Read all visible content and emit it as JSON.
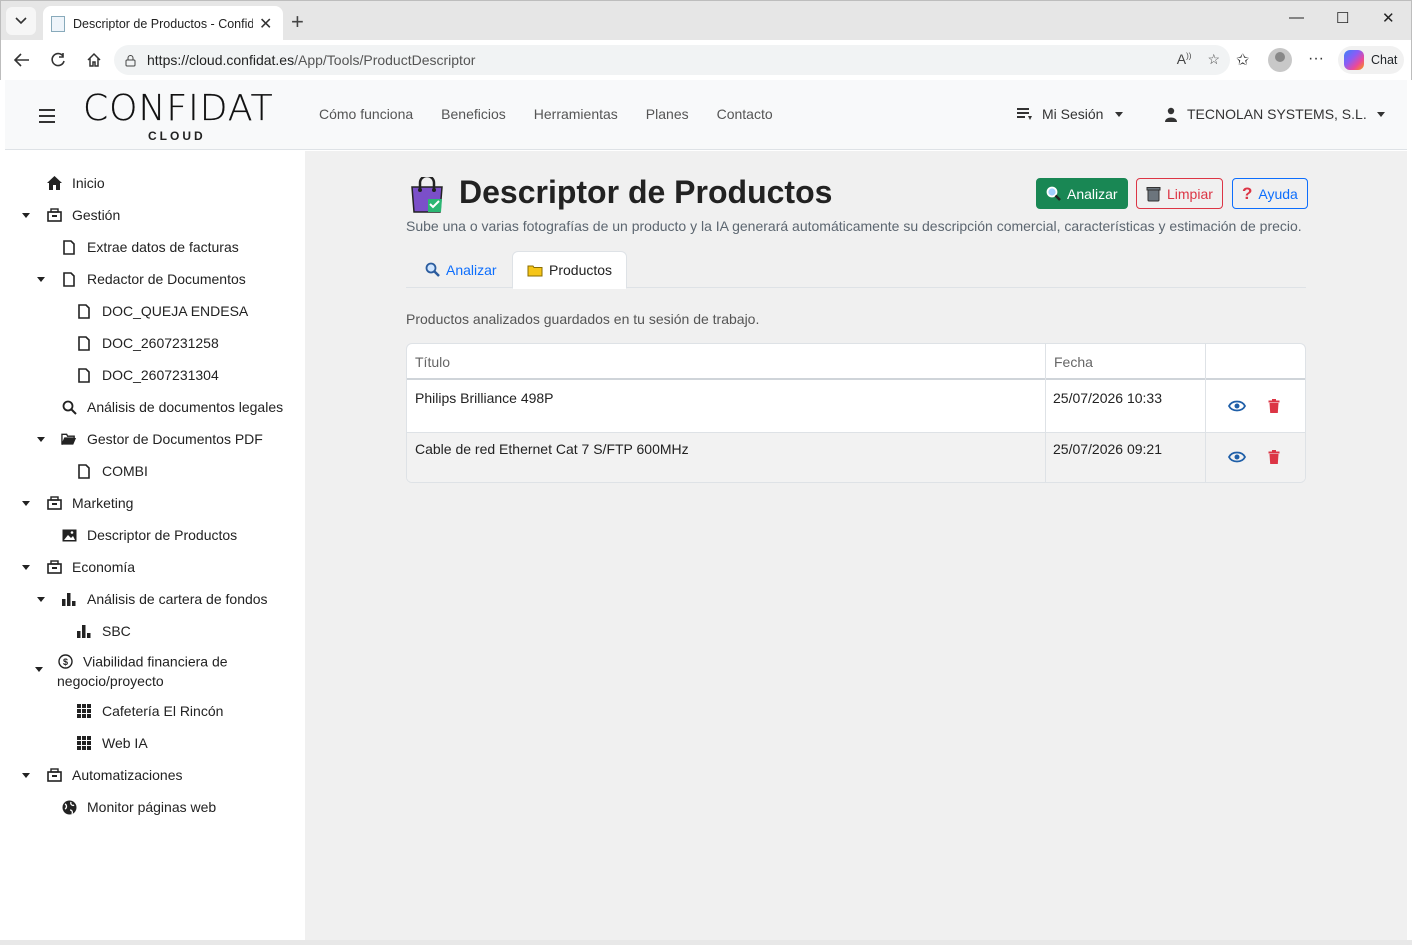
{
  "browser": {
    "tab_title": "Descriptor de Productos - Confidat Cloud",
    "tab_close": "✕",
    "new_tab": "+",
    "url_domain": "https://cloud.confidat.es",
    "url_path": "/App/Tools/ProductDescriptor",
    "chat_label": "Chat",
    "minimize": "—",
    "maximize": "☐",
    "close": "✕"
  },
  "header": {
    "logo_main": "CONFIDAT",
    "logo_sub": "CLOUD",
    "nav": [
      "Cómo funciona",
      "Beneficios",
      "Herramientas",
      "Planes",
      "Contacto"
    ],
    "session_label": "Mi Sesión",
    "company_label": "TECNOLAN SYSTEMS, S.L."
  },
  "sidebar": {
    "items": [
      {
        "label": "Inicio",
        "icon": "home-icon"
      },
      {
        "label": "Gestión",
        "icon": "folder-tree-icon"
      },
      {
        "label": "Extrae datos de facturas",
        "icon": "file-icon"
      },
      {
        "label": "Redactor de Documentos",
        "icon": "file-icon"
      },
      {
        "label": "DOC_QUEJA ENDESA",
        "icon": "file-icon"
      },
      {
        "label": "DOC_2607231258",
        "icon": "file-icon"
      },
      {
        "label": "DOC_2607231304",
        "icon": "file-icon"
      },
      {
        "label": "Análisis de documentos legales",
        "icon": "search-icon"
      },
      {
        "label": "Gestor de Documentos PDF",
        "icon": "folder-open-icon"
      },
      {
        "label": "COMBI",
        "icon": "file-icon"
      },
      {
        "label": "Marketing",
        "icon": "folder-tree-icon"
      },
      {
        "label": "Descriptor de Productos",
        "icon": "image-icon"
      },
      {
        "label": "Economía",
        "icon": "folder-tree-icon"
      },
      {
        "label": "Análisis de cartera de fondos",
        "icon": "bar-chart-icon"
      },
      {
        "label": "SBC",
        "icon": "bar-chart-icon"
      },
      {
        "label": "Viabilidad financiera de",
        "label2": "negocio/proyecto",
        "icon": "dollar-circle-icon"
      },
      {
        "label": "Cafetería El Rincón",
        "icon": "grid-icon"
      },
      {
        "label": "Web IA",
        "icon": "grid-icon"
      },
      {
        "label": "Automatizaciones",
        "icon": "folder-tree-icon"
      },
      {
        "label": "Monitor páginas web",
        "icon": "globe-icon"
      }
    ]
  },
  "main": {
    "title": "Descriptor de Productos",
    "subtitle": "Sube una o varias fotografías de un producto y la IA generará automáticamente su descripción comercial, características y estimación de precio.",
    "buttons": {
      "analizar": "Analizar",
      "limpiar": "Limpiar",
      "ayuda": "Ayuda"
    },
    "tabs": {
      "analizar": "Analizar",
      "productos": "Productos"
    },
    "description": "Productos analizados guardados en tu sesión de trabajo.",
    "table": {
      "headers": [
        "Título",
        "Fecha",
        ""
      ],
      "rows": [
        {
          "titulo": "Philips Brilliance 498P",
          "fecha": "25/07/2026 10:33"
        },
        {
          "titulo": "Cable de red Ethernet Cat 7 S/FTP 600MHz",
          "fecha": "25/07/2026 09:21"
        }
      ]
    }
  },
  "colors": {
    "success": "#198754",
    "danger": "#dc3545",
    "primary": "#0d6efd",
    "view_icon": "#1f5fa8",
    "delete_icon": "#dc3545"
  }
}
